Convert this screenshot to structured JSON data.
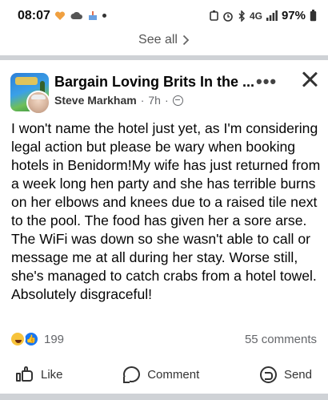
{
  "status_bar": {
    "time": "08:07",
    "battery": "97%",
    "network": "4G"
  },
  "see_all": {
    "label": "See all"
  },
  "post": {
    "group_name": "Bargain Loving Brits In the ...",
    "author": "Steve Markham",
    "time": "7h",
    "text": "I won't name the hotel just yet, as I'm considering legal action but please be wary when booking hotels in Benidorm!My wife has just returned from a week long hen party and she has terrible burns on her elbows and knees due to a raised tile next to the pool. The food has given her a sore arse. The WiFi was down so she wasn't able to call or message me at all during her stay. Worse still, she's managed to catch crabs from a hotel towel. Absolutely disgraceful!",
    "reaction_count": "199",
    "comments": "55 comments"
  },
  "actions": {
    "like": "Like",
    "comment": "Comment",
    "send": "Send"
  },
  "colors": {
    "accent": "#1877f2",
    "secondary_text": "#65676b",
    "divider": "#cfd2d6"
  }
}
